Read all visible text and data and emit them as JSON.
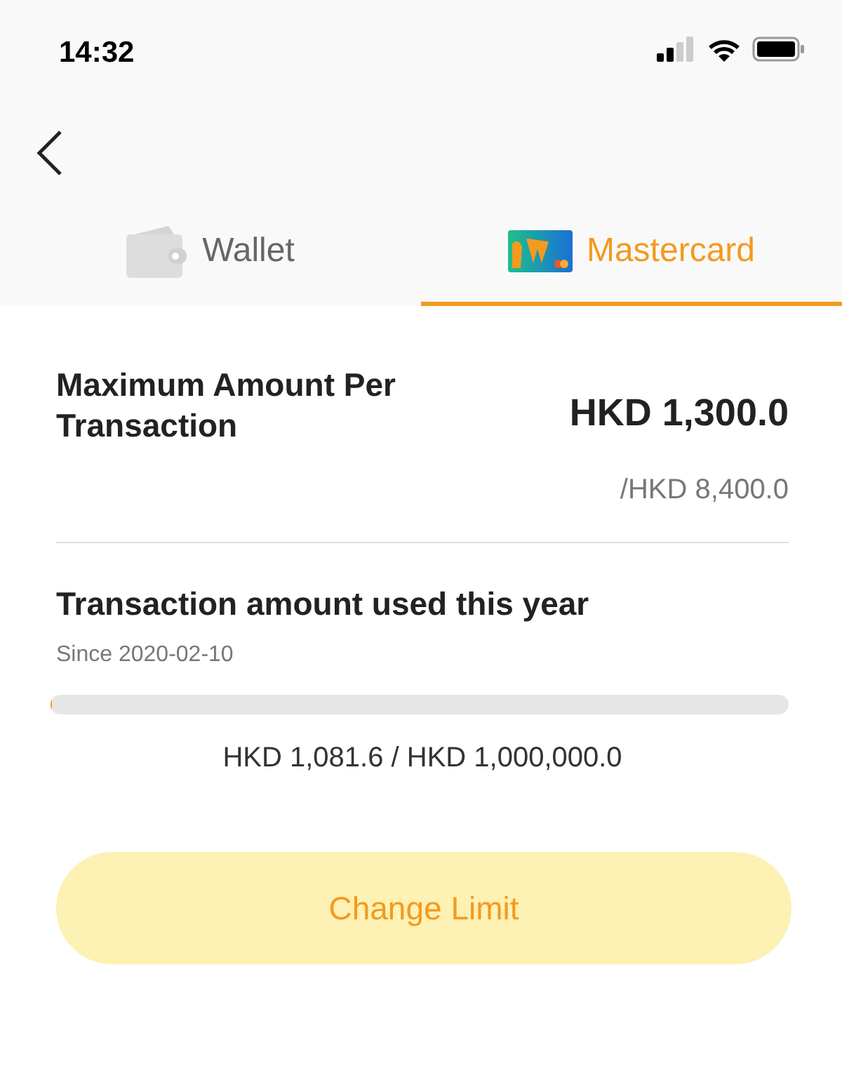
{
  "status_bar": {
    "time": "14:32"
  },
  "tabs": [
    {
      "label": "Wallet",
      "kind": "wallet",
      "selected": false
    },
    {
      "label": "Mastercard",
      "kind": "card",
      "selected": true
    }
  ],
  "limit": {
    "title": "Maximum Amount Per Transaction",
    "amount": "HKD 1,300.0",
    "max": "/HKD 8,400.0"
  },
  "usage": {
    "title": "Transaction amount used this year",
    "since": "Since 2020-02-10",
    "level": 0.001,
    "reading": "HKD 1,081.6 / HKD 1,000,000.0"
  },
  "button": "Change Limit"
}
